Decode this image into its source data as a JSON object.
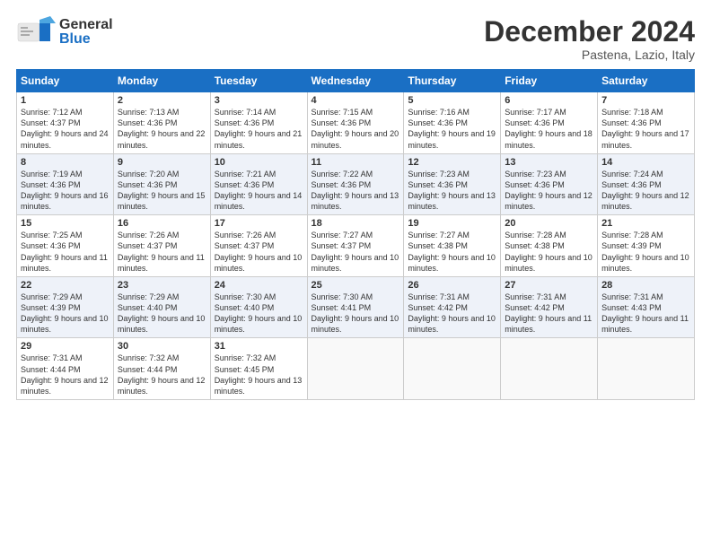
{
  "header": {
    "month": "December 2024",
    "location": "Pastena, Lazio, Italy",
    "logo_general": "General",
    "logo_blue": "Blue"
  },
  "days_of_week": [
    "Sunday",
    "Monday",
    "Tuesday",
    "Wednesday",
    "Thursday",
    "Friday",
    "Saturday"
  ],
  "weeks": [
    [
      {
        "day": "1",
        "sunrise": "Sunrise: 7:12 AM",
        "sunset": "Sunset: 4:37 PM",
        "daylight": "Daylight: 9 hours and 24 minutes."
      },
      {
        "day": "2",
        "sunrise": "Sunrise: 7:13 AM",
        "sunset": "Sunset: 4:36 PM",
        "daylight": "Daylight: 9 hours and 22 minutes."
      },
      {
        "day": "3",
        "sunrise": "Sunrise: 7:14 AM",
        "sunset": "Sunset: 4:36 PM",
        "daylight": "Daylight: 9 hours and 21 minutes."
      },
      {
        "day": "4",
        "sunrise": "Sunrise: 7:15 AM",
        "sunset": "Sunset: 4:36 PM",
        "daylight": "Daylight: 9 hours and 20 minutes."
      },
      {
        "day": "5",
        "sunrise": "Sunrise: 7:16 AM",
        "sunset": "Sunset: 4:36 PM",
        "daylight": "Daylight: 9 hours and 19 minutes."
      },
      {
        "day": "6",
        "sunrise": "Sunrise: 7:17 AM",
        "sunset": "Sunset: 4:36 PM",
        "daylight": "Daylight: 9 hours and 18 minutes."
      },
      {
        "day": "7",
        "sunrise": "Sunrise: 7:18 AM",
        "sunset": "Sunset: 4:36 PM",
        "daylight": "Daylight: 9 hours and 17 minutes."
      }
    ],
    [
      {
        "day": "8",
        "sunrise": "Sunrise: 7:19 AM",
        "sunset": "Sunset: 4:36 PM",
        "daylight": "Daylight: 9 hours and 16 minutes."
      },
      {
        "day": "9",
        "sunrise": "Sunrise: 7:20 AM",
        "sunset": "Sunset: 4:36 PM",
        "daylight": "Daylight: 9 hours and 15 minutes."
      },
      {
        "day": "10",
        "sunrise": "Sunrise: 7:21 AM",
        "sunset": "Sunset: 4:36 PM",
        "daylight": "Daylight: 9 hours and 14 minutes."
      },
      {
        "day": "11",
        "sunrise": "Sunrise: 7:22 AM",
        "sunset": "Sunset: 4:36 PM",
        "daylight": "Daylight: 9 hours and 13 minutes."
      },
      {
        "day": "12",
        "sunrise": "Sunrise: 7:23 AM",
        "sunset": "Sunset: 4:36 PM",
        "daylight": "Daylight: 9 hours and 13 minutes."
      },
      {
        "day": "13",
        "sunrise": "Sunrise: 7:23 AM",
        "sunset": "Sunset: 4:36 PM",
        "daylight": "Daylight: 9 hours and 12 minutes."
      },
      {
        "day": "14",
        "sunrise": "Sunrise: 7:24 AM",
        "sunset": "Sunset: 4:36 PM",
        "daylight": "Daylight: 9 hours and 12 minutes."
      }
    ],
    [
      {
        "day": "15",
        "sunrise": "Sunrise: 7:25 AM",
        "sunset": "Sunset: 4:36 PM",
        "daylight": "Daylight: 9 hours and 11 minutes."
      },
      {
        "day": "16",
        "sunrise": "Sunrise: 7:26 AM",
        "sunset": "Sunset: 4:37 PM",
        "daylight": "Daylight: 9 hours and 11 minutes."
      },
      {
        "day": "17",
        "sunrise": "Sunrise: 7:26 AM",
        "sunset": "Sunset: 4:37 PM",
        "daylight": "Daylight: 9 hours and 10 minutes."
      },
      {
        "day": "18",
        "sunrise": "Sunrise: 7:27 AM",
        "sunset": "Sunset: 4:37 PM",
        "daylight": "Daylight: 9 hours and 10 minutes."
      },
      {
        "day": "19",
        "sunrise": "Sunrise: 7:27 AM",
        "sunset": "Sunset: 4:38 PM",
        "daylight": "Daylight: 9 hours and 10 minutes."
      },
      {
        "day": "20",
        "sunrise": "Sunrise: 7:28 AM",
        "sunset": "Sunset: 4:38 PM",
        "daylight": "Daylight: 9 hours and 10 minutes."
      },
      {
        "day": "21",
        "sunrise": "Sunrise: 7:28 AM",
        "sunset": "Sunset: 4:39 PM",
        "daylight": "Daylight: 9 hours and 10 minutes."
      }
    ],
    [
      {
        "day": "22",
        "sunrise": "Sunrise: 7:29 AM",
        "sunset": "Sunset: 4:39 PM",
        "daylight": "Daylight: 9 hours and 10 minutes."
      },
      {
        "day": "23",
        "sunrise": "Sunrise: 7:29 AM",
        "sunset": "Sunset: 4:40 PM",
        "daylight": "Daylight: 9 hours and 10 minutes."
      },
      {
        "day": "24",
        "sunrise": "Sunrise: 7:30 AM",
        "sunset": "Sunset: 4:40 PM",
        "daylight": "Daylight: 9 hours and 10 minutes."
      },
      {
        "day": "25",
        "sunrise": "Sunrise: 7:30 AM",
        "sunset": "Sunset: 4:41 PM",
        "daylight": "Daylight: 9 hours and 10 minutes."
      },
      {
        "day": "26",
        "sunrise": "Sunrise: 7:31 AM",
        "sunset": "Sunset: 4:42 PM",
        "daylight": "Daylight: 9 hours and 10 minutes."
      },
      {
        "day": "27",
        "sunrise": "Sunrise: 7:31 AM",
        "sunset": "Sunset: 4:42 PM",
        "daylight": "Daylight: 9 hours and 11 minutes."
      },
      {
        "day": "28",
        "sunrise": "Sunrise: 7:31 AM",
        "sunset": "Sunset: 4:43 PM",
        "daylight": "Daylight: 9 hours and 11 minutes."
      }
    ],
    [
      {
        "day": "29",
        "sunrise": "Sunrise: 7:31 AM",
        "sunset": "Sunset: 4:44 PM",
        "daylight": "Daylight: 9 hours and 12 minutes."
      },
      {
        "day": "30",
        "sunrise": "Sunrise: 7:32 AM",
        "sunset": "Sunset: 4:44 PM",
        "daylight": "Daylight: 9 hours and 12 minutes."
      },
      {
        "day": "31",
        "sunrise": "Sunrise: 7:32 AM",
        "sunset": "Sunset: 4:45 PM",
        "daylight": "Daylight: 9 hours and 13 minutes."
      },
      null,
      null,
      null,
      null
    ]
  ]
}
